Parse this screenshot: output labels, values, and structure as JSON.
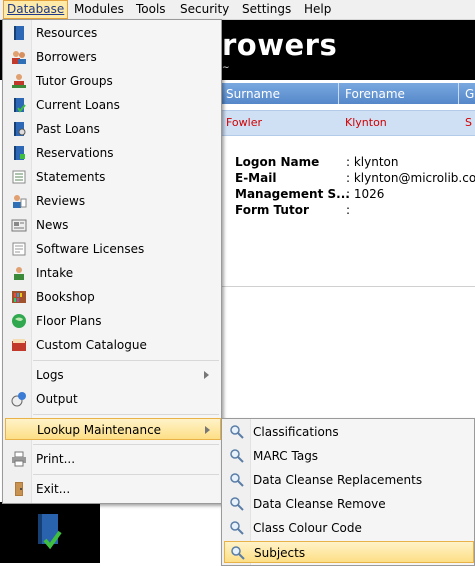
{
  "menubar": {
    "items": [
      "Database",
      "Modules",
      "Tools",
      "Security",
      "Settings",
      "Help"
    ],
    "active": "Database"
  },
  "background": {
    "title": "rowers",
    "grid_headers": [
      "Surname",
      "Forename",
      "G"
    ],
    "grid_row": [
      "Fowler",
      "Klynton",
      "S"
    ],
    "details": [
      {
        "label": "Logon Name",
        "value": ": klynton"
      },
      {
        "label": "E-Mail",
        "value": ": klynton@microlib.co.u"
      },
      {
        "label": "Management S...",
        "value": ": 1026"
      },
      {
        "label": "Form Tutor",
        "value": ":"
      }
    ]
  },
  "dropdown": {
    "items": [
      {
        "label": "Resources",
        "icon": "book-icon"
      },
      {
        "label": "Borrowers",
        "icon": "people-icon"
      },
      {
        "label": "Tutor Groups",
        "icon": "group-icon"
      },
      {
        "label": "Current Loans",
        "icon": "book-check-icon"
      },
      {
        "label": "Past Loans",
        "icon": "book-history-icon"
      },
      {
        "label": "Reservations",
        "icon": "book-reserve-icon"
      },
      {
        "label": "Statements",
        "icon": "statement-icon"
      },
      {
        "label": "Reviews",
        "icon": "review-icon"
      },
      {
        "label": "News",
        "icon": "newspaper-icon"
      },
      {
        "label": "Software Licenses",
        "icon": "license-icon"
      },
      {
        "label": "Intake",
        "icon": "intake-icon"
      },
      {
        "label": "Bookshop",
        "icon": "bookshop-icon"
      },
      {
        "label": "Floor Plans",
        "icon": "globe-icon"
      },
      {
        "label": "Custom Catalogue",
        "icon": "catalogue-icon"
      }
    ],
    "logs": "Logs",
    "output": "Output",
    "lookup": "Lookup Maintenance",
    "print": "Print...",
    "exit": "Exit..."
  },
  "submenu": {
    "items": [
      "Classifications",
      "MARC Tags",
      "Data Cleanse Replacements",
      "Data Cleanse Remove",
      "Class Colour Code",
      "Subjects"
    ],
    "highlighted": "Subjects"
  },
  "colors": {
    "menu_highlight": "#fddf86",
    "header_blue": "#5587c9",
    "row_red": "#d10000"
  }
}
